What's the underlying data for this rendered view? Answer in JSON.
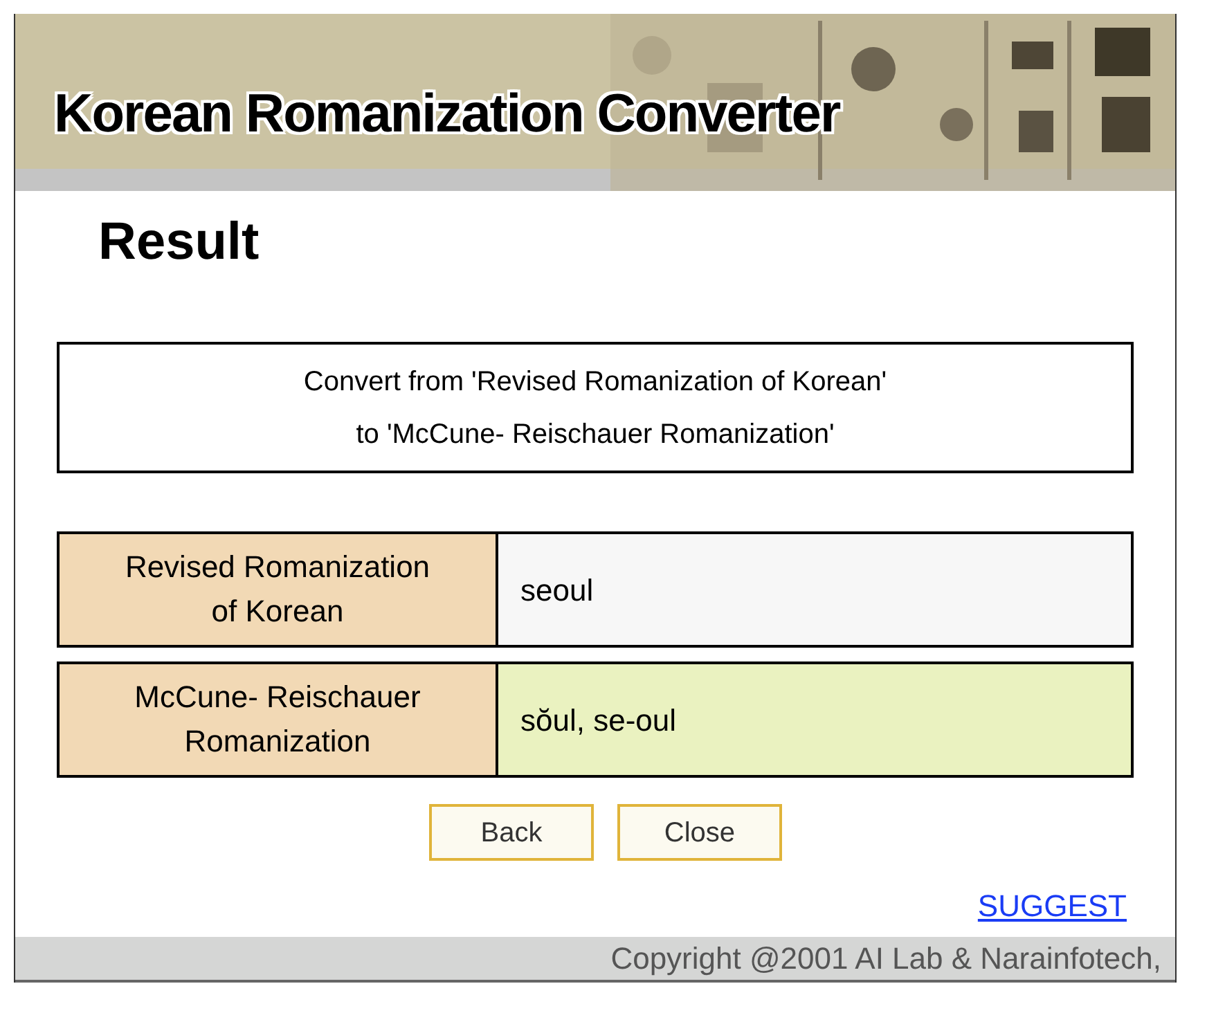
{
  "header": {
    "title": "Korean Romanization Converter"
  },
  "heading": "Result",
  "direction": {
    "lines": [
      "Convert from 'Revised Romanization of Korean'",
      "to 'McCune- Reischauer Romanization'"
    ]
  },
  "rows": [
    {
      "label": "Revised Romanization of Korean",
      "value": "seoul",
      "kind": "input"
    },
    {
      "label": "McCune- Reischauer Romanization",
      "value": "sŏul, se-oul",
      "kind": "output"
    }
  ],
  "buttons": [
    "Back",
    "Close"
  ],
  "link": "SUGGEST",
  "footer": "Copyright @2001 AI Lab & Narainfotech,"
}
